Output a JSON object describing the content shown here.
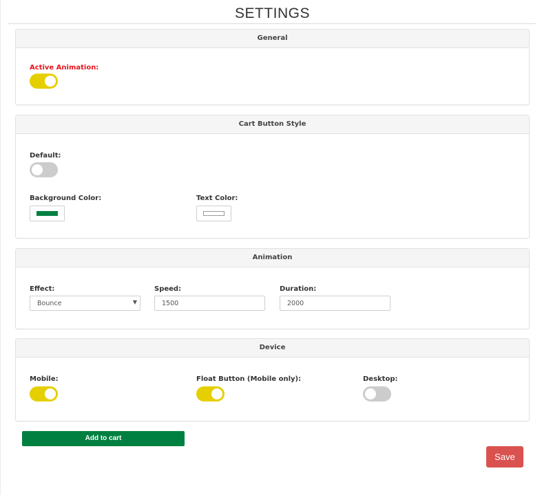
{
  "page": {
    "title": "SETTINGS"
  },
  "colors": {
    "toggle_on": "#e6cf00",
    "toggle_off": "#cccccc",
    "highlight_label": "#e8151b",
    "cart_button_bg": "#008040",
    "cart_button_text": "#ffffff",
    "save_button": "#da524f"
  },
  "general": {
    "header": "General",
    "active_animation": {
      "label": "Active Animation:",
      "on": true
    }
  },
  "cart_button_style": {
    "header": "Cart Button Style",
    "default": {
      "label": "Default:",
      "on": false
    },
    "background_color": {
      "label": "Background Color:",
      "value": "#008040"
    },
    "text_color": {
      "label": "Text Color:",
      "value": "#ffffff"
    }
  },
  "animation": {
    "header": "Animation",
    "effect": {
      "label": "Effect:",
      "value": "Bounce"
    },
    "speed": {
      "label": "Speed:",
      "value": "1500"
    },
    "duration": {
      "label": "Duration:",
      "value": "2000"
    }
  },
  "device": {
    "header": "Device",
    "mobile": {
      "label": "Mobile:",
      "on": true
    },
    "float_button": {
      "label": "Float Button (Mobile only):",
      "on": true
    },
    "desktop": {
      "label": "Desktop:",
      "on": false
    }
  },
  "preview": {
    "add_to_cart_label": "Add to cart"
  },
  "actions": {
    "save_label": "Save"
  }
}
